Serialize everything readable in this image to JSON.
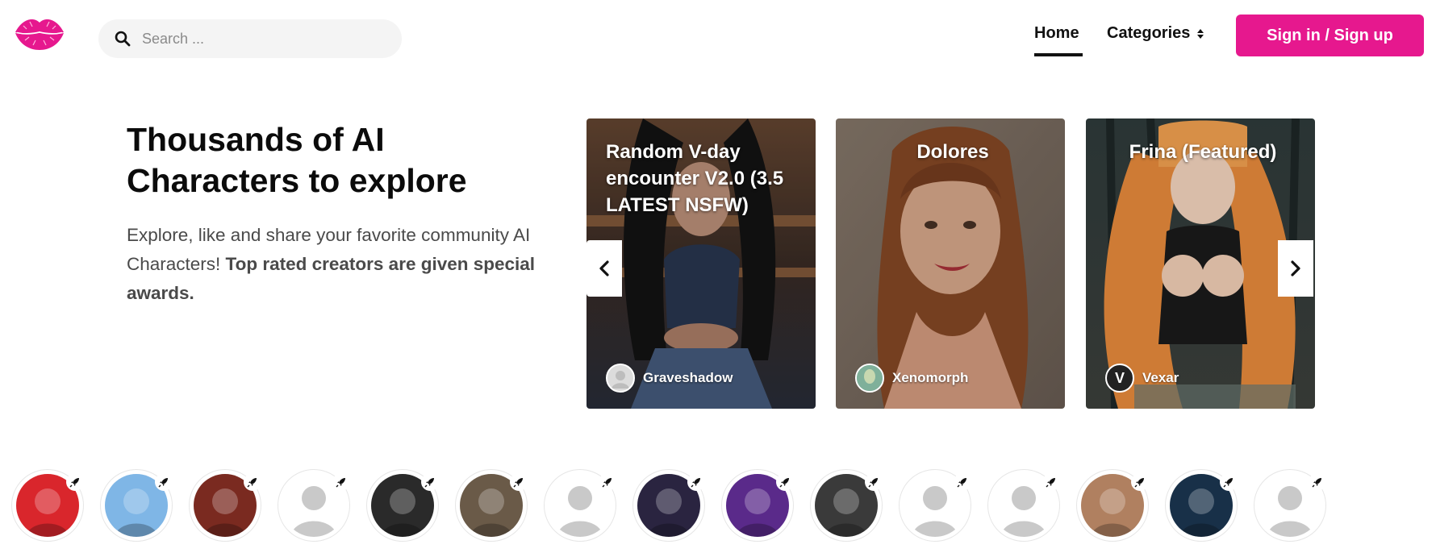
{
  "header": {
    "logo_icon": "lips-logo-icon",
    "search": {
      "placeholder": "Search ...",
      "icon": "search-icon"
    },
    "nav": {
      "home": "Home",
      "categories": "Categories"
    },
    "signin_label": "Sign in / Sign up",
    "accent_color": "#e6188e"
  },
  "hero": {
    "title": "Thousands of AI Characters to explore",
    "desc_plain": "Explore, like and share your favorite community AI Characters! ",
    "desc_bold": "Top rated creators are given special awards."
  },
  "carousel": {
    "cards": [
      {
        "title": "Random V-day encounter V2.0 (3.5 LATEST NSFW)",
        "author": "Graveshadow"
      },
      {
        "title": "Dolores",
        "author": "Xenomorph"
      },
      {
        "title": "Frina (Featured)",
        "author": "Vexar",
        "author_badge": "V"
      }
    ],
    "prev_icon": "chevron-left-icon",
    "next_icon": "chevron-right-icon"
  },
  "creators": {
    "count": 15,
    "badge_icon": "rocket-icon"
  }
}
